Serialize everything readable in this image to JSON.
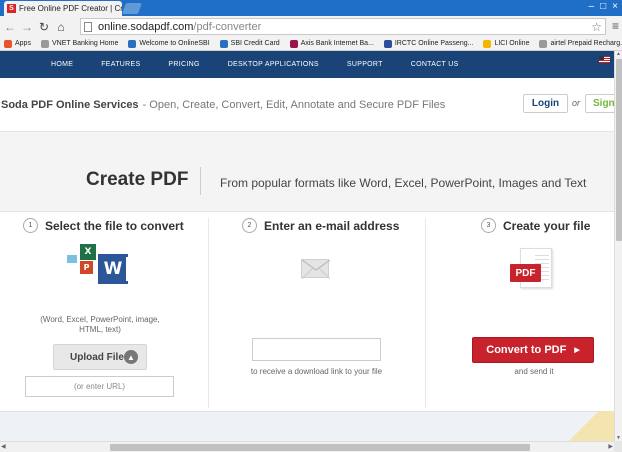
{
  "browser": {
    "tab_title": "Free Online PDF Creator | Cr",
    "tab_favicon": "S",
    "url_host": "online.sodapdf.com",
    "url_path": "/pdf-converter",
    "window_controls": [
      "–",
      "□",
      "×"
    ],
    "bookmarks": [
      {
        "label": "Apps",
        "icon": "apps-grid-icon",
        "color": "#e8552b"
      },
      {
        "label": "VNET Banking Home",
        "icon": "page-icon",
        "color": "#999999"
      },
      {
        "label": "Welcome to OnlineSBI",
        "icon": "sbi-icon",
        "color": "#2a6fbd"
      },
      {
        "label": "SBI Credit Card",
        "icon": "sbi-icon",
        "color": "#2a6fbd"
      },
      {
        "label": "Axis Bank Internet Ba...",
        "icon": "axis-icon",
        "color": "#97144d"
      },
      {
        "label": "IRCTC Online Passeng...",
        "icon": "irctc-icon",
        "color": "#2d4f9b"
      },
      {
        "label": "LICI Online",
        "icon": "lic-icon",
        "color": "#f4b400"
      },
      {
        "label": "airtel Prepaid Recharg...",
        "icon": "page-icon",
        "color": "#999999"
      }
    ]
  },
  "site_nav": {
    "items": [
      "HOME",
      "FEATURES",
      "PRICING",
      "DESKTOP APPLICATIONS",
      "SUPPORT",
      "CONTACT US"
    ]
  },
  "brand": {
    "title": "Soda PDF Online Services",
    "subtitle": "- Open, Create, Convert, Edit, Annotate and Secure PDF Files",
    "login": "Login",
    "or": "or",
    "signup": "Sign"
  },
  "hero": {
    "title": "Create PDF",
    "subtitle": "From popular formats like Word, Excel, PowerPoint, Images and Text"
  },
  "steps": [
    {
      "num": "1",
      "title": "Select the file to convert",
      "desc": "(Word, Excel, PowerPoint, image, HTML, text)"
    },
    {
      "num": "2",
      "title": "Enter an e-mail address",
      "desc": "to receive a download link to your file"
    },
    {
      "num": "3",
      "title": "Create your file",
      "desc": "and send it"
    }
  ],
  "actions": {
    "upload_label": "Upload File",
    "url_placeholder": "(or enter URL)",
    "convert_label": "Convert to PDF",
    "pdf_badge": "PDF"
  },
  "colors": {
    "nav_bg": "#1a4378",
    "convert_red": "#c8232c",
    "signup_green": "#6fb83d"
  }
}
